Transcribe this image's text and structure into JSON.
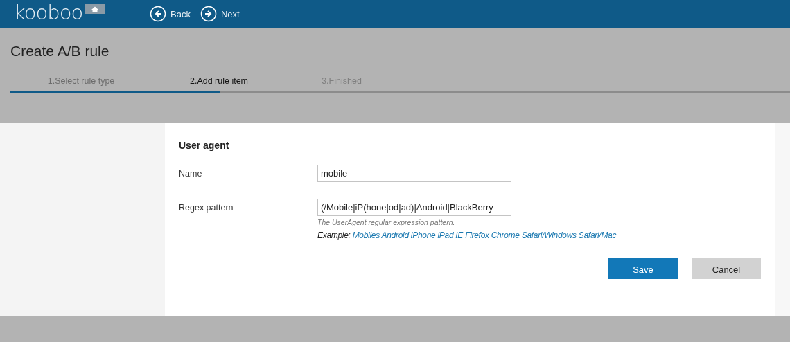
{
  "header": {
    "logo": "kooboo",
    "nav": [
      {
        "kind": "back",
        "label": "Back"
      },
      {
        "kind": "next",
        "label": "Next"
      }
    ]
  },
  "page": {
    "title": "Create A/B rule",
    "steps": [
      {
        "label": "1.Select rule type",
        "completed": true,
        "selected": false
      },
      {
        "label": "2.Add rule item",
        "completed": false,
        "selected": true
      },
      {
        "label": "3.Finished",
        "completed": false,
        "selected": false
      }
    ],
    "progress": {
      "level": 0.268
    }
  },
  "dialog": {
    "title": "User agent",
    "fields": [
      {
        "label": "Name",
        "value": "mobile"
      },
      {
        "label": "Regex pattern",
        "value": "(/Mobile|iP(hone|od|ad)|Android|BlackBerry",
        "hint": "The UserAgent regular expression pattern.",
        "example_label": "Example:",
        "example_links": [
          "Mobiles",
          "Android",
          "iPhone",
          "iPad",
          "IE",
          "Firefox",
          "Chrome",
          "Safari/Windows",
          "Safari/Mac"
        ]
      }
    ],
    "buttons": [
      {
        "kind": "primary",
        "label": "Save"
      },
      {
        "kind": "secondary",
        "label": "Cancel"
      }
    ]
  }
}
